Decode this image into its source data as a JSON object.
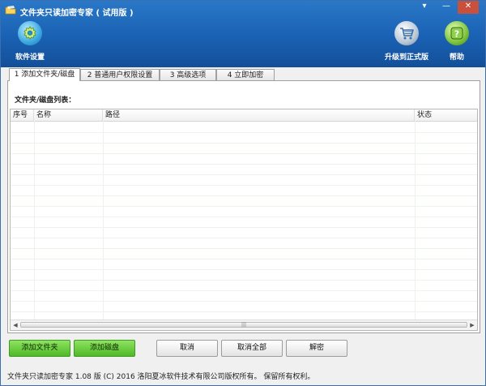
{
  "window": {
    "title": "文件夹只读加密专家 ( 试用版 )",
    "controls": {
      "menu": "▾",
      "minimize": "—",
      "close": "✕"
    }
  },
  "toolbar": {
    "settings_label": "软件设置",
    "upgrade_label": "升级到正式版",
    "help_label": "帮助"
  },
  "tabs": [
    {
      "label": "1 添加文件夹/磁盘",
      "active": true
    },
    {
      "label": "2 普通用户权限设置",
      "active": false
    },
    {
      "label": "3 高级选项",
      "active": false
    },
    {
      "label": "4 立即加密",
      "active": false
    }
  ],
  "panel": {
    "list_label": "文件夹/磁盘列表：",
    "columns": [
      "序号",
      "名称",
      "路径",
      "状态"
    ],
    "rows": []
  },
  "buttons": {
    "add_folder": "添加文件夹",
    "add_disk": "添加磁盘",
    "cancel": "取消",
    "cancel_all": "取消全部",
    "decrypt": "解密"
  },
  "statusbar": {
    "text": "文件夹只读加密专家 1.08 版  (C)  2016 洛阳夏冰软件技术有限公司版权所有。 保留所有权利。"
  },
  "colors": {
    "header": "#1a61b3",
    "green_button": "#4fb82a",
    "settings_icon": "#3aa8e0",
    "help_icon": "#7cc23c"
  }
}
